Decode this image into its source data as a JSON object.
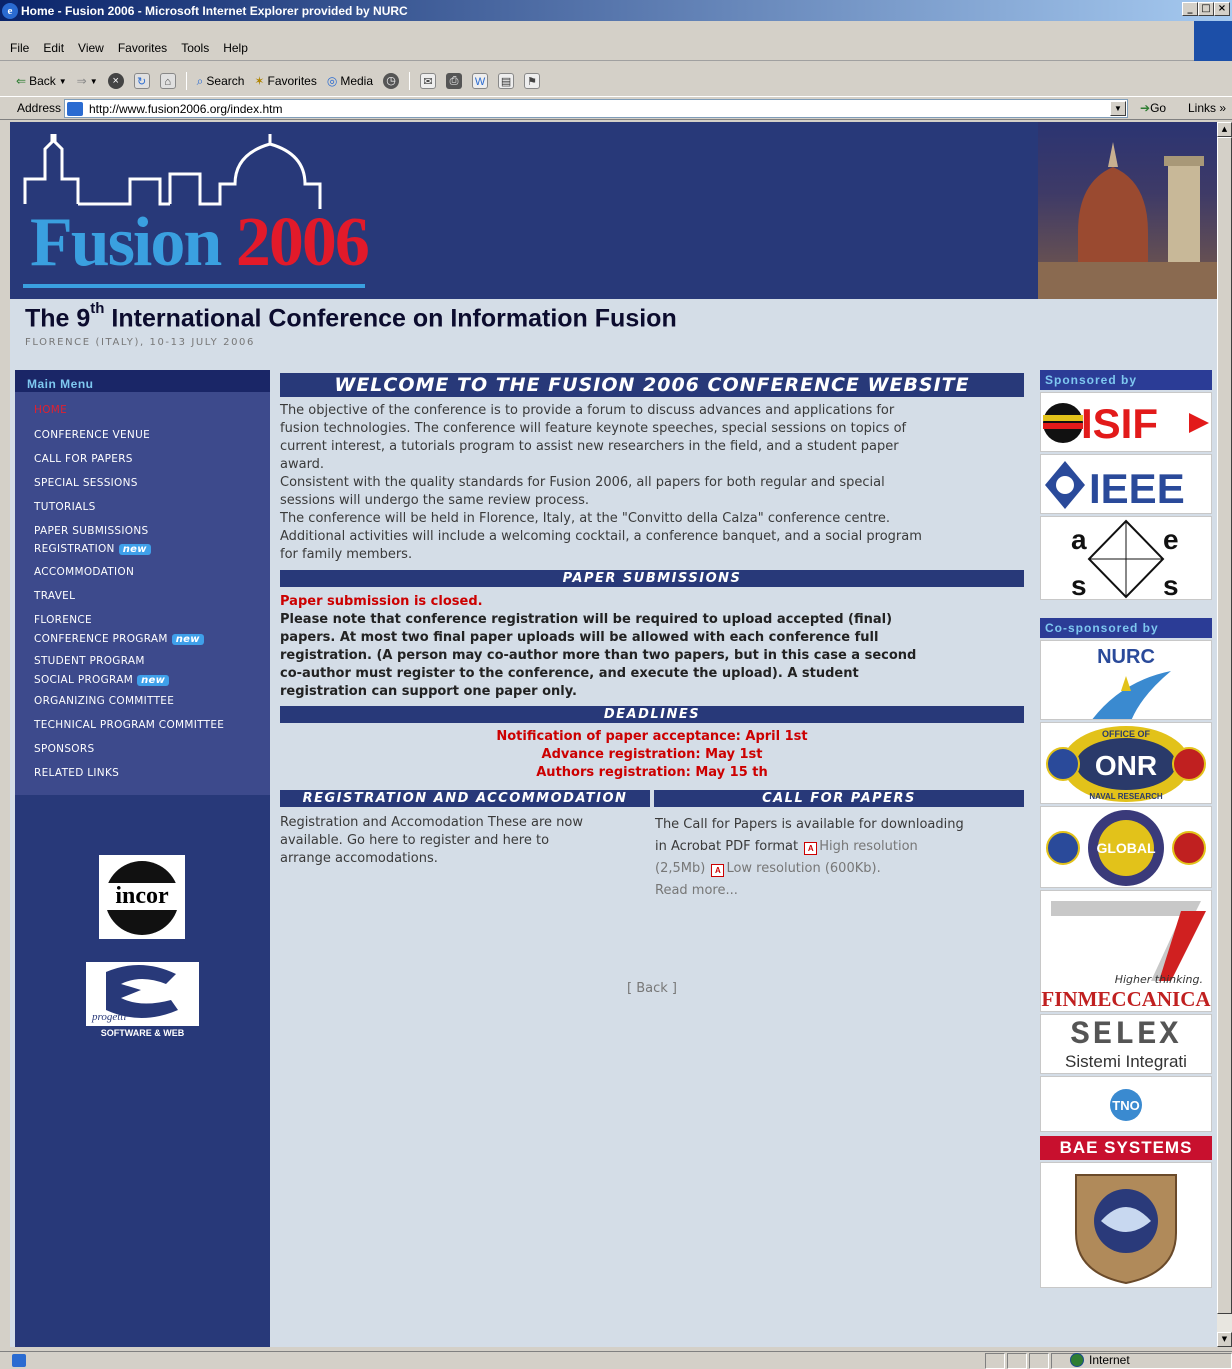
{
  "window": {
    "title": "Home - Fusion 2006 - Microsoft Internet Explorer provided by NURC"
  },
  "menubar": [
    "File",
    "Edit",
    "View",
    "Favorites",
    "Tools",
    "Help"
  ],
  "toolbar": {
    "back": "Back",
    "search": "Search",
    "favorites": "Favorites",
    "media": "Media"
  },
  "address": {
    "label": "Address",
    "url": "http://www.fusion2006.org/index.htm",
    "go": "Go",
    "links": "Links"
  },
  "status": {
    "zone": "Internet"
  },
  "banner": {
    "logo_word": "Fusion",
    "logo_year": "2006"
  },
  "header": {
    "title_pre": "The 9",
    "title_sup": "th",
    "title_post": " International Conference on Information Fusion",
    "subtitle": "FLORENCE (ITALY),   10-13 JULY 2006"
  },
  "menu": {
    "heading": "Main Menu",
    "items": [
      {
        "label": "HOME",
        "new": ""
      },
      {
        "label": "CONFERENCE VENUE",
        "new": ""
      },
      {
        "label": "CALL FOR PAPERS",
        "new": ""
      },
      {
        "label": "SPECIAL SESSIONS",
        "new": ""
      },
      {
        "label": "TUTORIALS",
        "new": ""
      },
      {
        "label": "PAPER SUBMISSIONS",
        "new": ""
      },
      {
        "label": "REGISTRATION",
        "new": "new"
      },
      {
        "label": "ACCOMMODATION",
        "new": ""
      },
      {
        "label": "TRAVEL",
        "new": ""
      },
      {
        "label": "FLORENCE",
        "new": ""
      },
      {
        "label": "CONFERENCE PROGRAM",
        "new": "new"
      },
      {
        "label": "STUDENT PROGRAM",
        "new": ""
      },
      {
        "label": "SOCIAL PROGRAM",
        "new": "new"
      },
      {
        "label": "ORGANIZING COMMITTEE",
        "new": ""
      },
      {
        "label": "TECHNICAL PROGRAM COMMITTEE",
        "new": ""
      },
      {
        "label": "SPONSORS",
        "new": ""
      },
      {
        "label": "RELATED LINKS",
        "new": ""
      }
    ],
    "logo_incor": "incor",
    "logo_e3_script": "progetti",
    "logo_e3_band": "SOFTWARE & WEB"
  },
  "welcome": {
    "heading": "WELCOME TO THE FUSION 2006 CONFERENCE WEBSITE",
    "lines": [
      "The objective of the conference is to provide a forum to discuss advances and applications for",
      "fusion technologies. The conference will feature keynote speeches, special sessions on topics of",
      "current interest, a tutorials program to assist new researchers in the field, and a student paper",
      "award.",
      "Consistent with the quality standards for Fusion 2006, all papers for both regular and special",
      "sessions will undergo the same review process.",
      "The conference will be held in Florence, Italy, at the \"Convitto della Calza\" conference centre.",
      "Additional activities will include a welcoming cocktail, a conference banquet, and a social program",
      "for family members."
    ]
  },
  "papers": {
    "heading": "PAPER SUBMISSIONS",
    "closed": "Paper submission is closed.",
    "lines": [
      "Please note that conference registration will be required to upload accepted (final)",
      "papers. At most two final paper uploads will be allowed with each conference full",
      "registration. (A person may co-author more than two papers, but in this case a second",
      "co-author must register to the conference, and execute the upload). A student",
      "registration can support one paper only."
    ]
  },
  "deadlines": {
    "heading": "DEADLINES",
    "items": [
      "Notification of paper acceptance: April 1st",
      "Advance registration: May 1st",
      "Authors registration: May 15 th"
    ]
  },
  "registration": {
    "heading": "REGISTRATION AND ACCOMMODATION",
    "lines": [
      "Registration and Accomodation These are now",
      "available.  Go here to register and here to",
      "arrange accomodations."
    ]
  },
  "cfp": {
    "heading": "CALL FOR PAPERS",
    "line1": "The Call for Papers is available for downloading",
    "line2_a": "in Acrobat PDF format",
    "line2_b": "High resolution",
    "line3_a": "(2,5Mb)",
    "line3_b": "Low resolution (600Kb).",
    "read_more": "Read more..."
  },
  "back": "[ Back ]",
  "sponsors": {
    "heading": "Sponsored by",
    "cosponsor_heading": "Co-sponsored by",
    "isif": "ISIF",
    "ieee": "IEEE",
    "aess": [
      "a",
      "e",
      "s",
      "s"
    ],
    "nurc": "NURC",
    "onr_top": "OFFICE OF",
    "onr_mid": "ONR",
    "onr_bottom": "NAVAL RESEARCH",
    "global": "GLOBAL",
    "fin_tag": "Higher thinking.",
    "fin_name": "FINMECCANICA",
    "selex": "SELEX",
    "selex_sub": "Sistemi Integrati",
    "tno": "TNO",
    "bae": "BAE SYSTEMS"
  }
}
